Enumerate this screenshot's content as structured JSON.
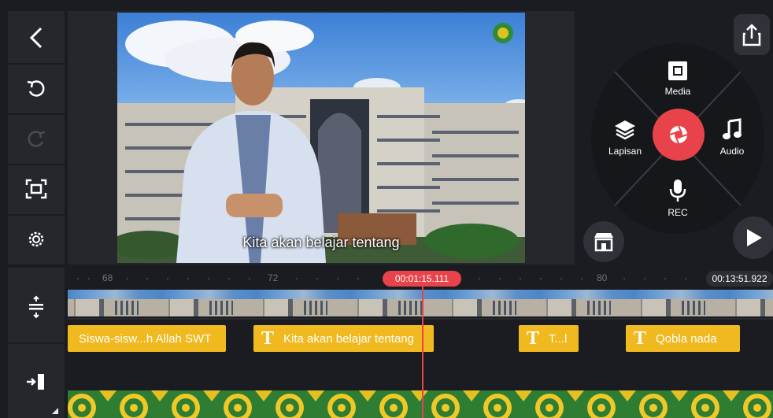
{
  "preview": {
    "caption": "Kita akan belajar tentang"
  },
  "wheel": {
    "media_label": "Media",
    "layer_label": "Lapisan",
    "audio_label": "Audio",
    "rec_label": "REC"
  },
  "timeline": {
    "ruler_ticks": [
      "68",
      "72",
      "80"
    ],
    "current_time": "00:01:15.111",
    "total_time": "00:13:51.922",
    "text_clips": [
      {
        "label": "Siswa-sisw...h Allah SWT"
      },
      {
        "label": "Kita akan belajar tentang"
      },
      {
        "label": "T...l"
      },
      {
        "label": "Qobla nada"
      }
    ],
    "text_clip_icon": "T"
  },
  "colors": {
    "accent": "#e8434a",
    "text_clip": "#f0b920",
    "panel": "#26272d",
    "background": "#1b1c21"
  },
  "icons": {
    "left_toolbar": [
      "back-arrow-icon",
      "undo-icon",
      "redo-icon",
      "fit-screen-icon",
      "settings-gear-icon"
    ],
    "timeline_left": [
      "track-height-icon",
      "jump-to-end-icon"
    ],
    "right_panel": [
      "share-export-icon",
      "media-icon",
      "layer-icon",
      "audio-note-icon",
      "microphone-icon",
      "camera-record-icon",
      "asset-store-icon",
      "play-icon"
    ]
  }
}
